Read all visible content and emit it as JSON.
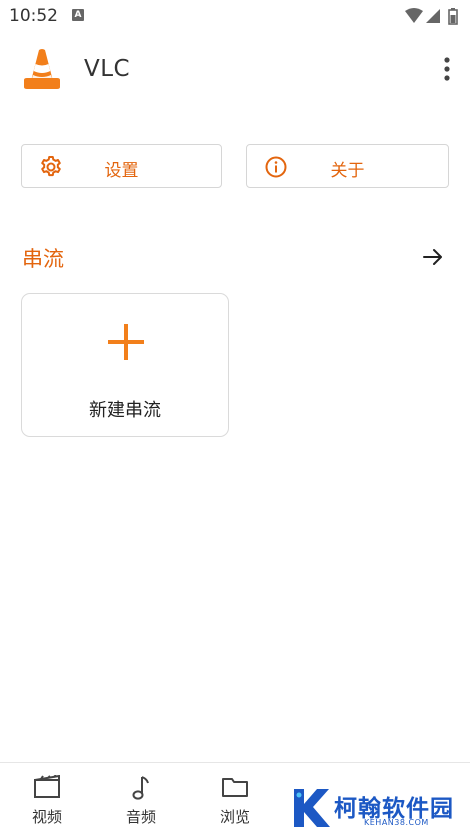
{
  "status_bar": {
    "time": "10:52",
    "notification_letter": "A",
    "icons": [
      "wifi-icon",
      "signal-icon",
      "battery-icon"
    ]
  },
  "app_bar": {
    "title": "VLC",
    "logo": "vlc-cone-icon",
    "menu_icon": "more-vert-icon"
  },
  "actions": {
    "settings_label": "设置",
    "about_label": "关于"
  },
  "streams": {
    "section_title": "串流",
    "new_stream_label": "新建串流"
  },
  "bottom_nav": {
    "items": [
      {
        "label": "视频",
        "icon": "movie-icon"
      },
      {
        "label": "音频",
        "icon": "music-note-icon"
      },
      {
        "label": "浏览",
        "icon": "folder-icon"
      }
    ]
  },
  "watermark": {
    "text": "柯翰软件园",
    "sub": "KEHAN38.COM"
  },
  "colors": {
    "accent": "#e3650e",
    "text": "#222222",
    "border": "#d6d6d6",
    "watermark": "#1c58c4"
  }
}
